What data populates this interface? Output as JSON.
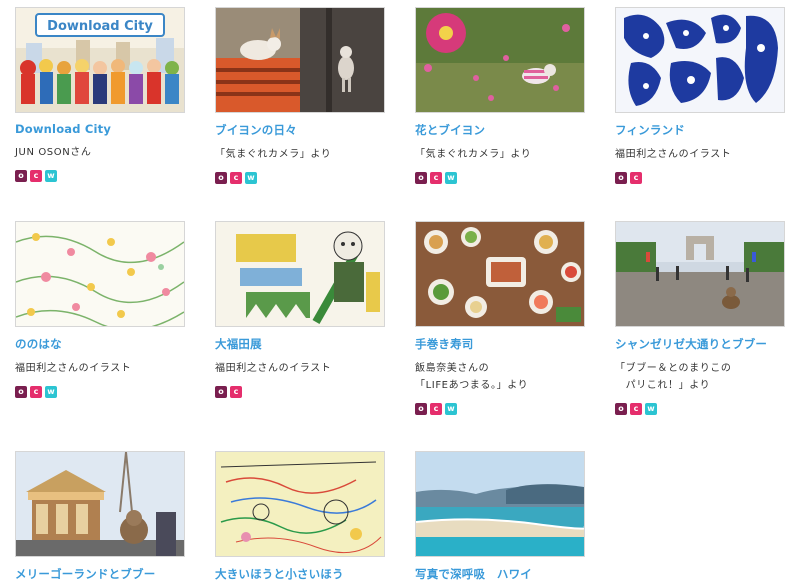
{
  "cards": [
    {
      "title": "Download City",
      "desc": "JUN OSONさん",
      "thumb_text": "Download City",
      "badges": [
        "o",
        "c",
        "w"
      ]
    },
    {
      "title": "ブイヨンの日々",
      "desc": "「気まぐれカメラ」より",
      "badges": [
        "o",
        "c",
        "w"
      ]
    },
    {
      "title": "花とブイヨン",
      "desc": "「気まぐれカメラ」より",
      "badges": [
        "o",
        "c",
        "w"
      ]
    },
    {
      "title": "フィンランド",
      "desc": "福田利之さんのイラスト",
      "badges": [
        "o",
        "c"
      ]
    },
    {
      "title": "ののはな",
      "desc": "福田利之さんのイラスト",
      "badges": [
        "o",
        "c",
        "w"
      ]
    },
    {
      "title": "大福田展",
      "desc": "福田利之さんのイラスト",
      "badges": [
        "o",
        "c"
      ]
    },
    {
      "title": "手巻き寿司",
      "desc": "飯島奈美さんの\n「LIFEあつまる。」より",
      "badges": [
        "o",
        "c",
        "w"
      ]
    },
    {
      "title": "シャンゼリゼ大通りとブブー",
      "desc": "「ブブー＆とのまりこの\n　パリこれ！」より",
      "badges": [
        "o",
        "c",
        "w"
      ]
    },
    {
      "title": "メリーゴーランドとブブー",
      "desc": "",
      "badges": []
    },
    {
      "title": "大きいほうと小さいほう",
      "desc": "",
      "badges": []
    },
    {
      "title": "写真で深呼吸　ハワイ",
      "desc": "",
      "badges": []
    }
  ],
  "badge_labels": {
    "o": "o",
    "c": "c",
    "w": "w"
  },
  "colors": {
    "title": "#3a9ad9",
    "badge_o": "#7a1f4f",
    "badge_c": "#e52e6c",
    "badge_w": "#2cc4d2"
  }
}
